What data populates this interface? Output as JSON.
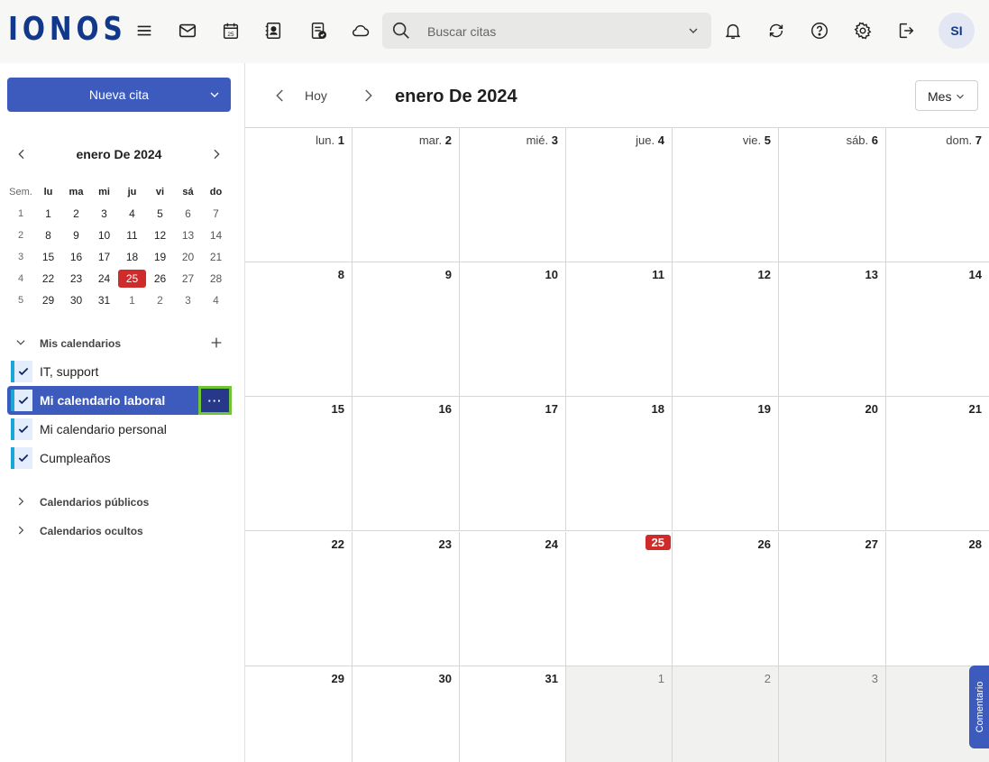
{
  "topbar": {
    "logo": "IONOS",
    "icons": [
      "menu-icon",
      "mail-icon",
      "calendar-icon",
      "contacts-icon",
      "tasks-icon",
      "cloud-icon"
    ],
    "calendar_icon_day": "25",
    "search_placeholder": "Buscar citas",
    "right_icons": [
      "bell-icon",
      "refresh-icon",
      "help-icon",
      "gear-icon",
      "logout-icon"
    ],
    "avatar": "SI"
  },
  "sidebar": {
    "new_button": "Nueva cita",
    "mini": {
      "title": "enero De 2024",
      "week_header": "Sem.",
      "day_headers": [
        "lu",
        "ma",
        "mi",
        "ju",
        "vi",
        "sá",
        "do"
      ],
      "weeks": [
        {
          "wk": "1",
          "days": [
            "1",
            "2",
            "3",
            "4",
            "5",
            "6",
            "7"
          ]
        },
        {
          "wk": "2",
          "days": [
            "8",
            "9",
            "10",
            "11",
            "12",
            "13",
            "14"
          ]
        },
        {
          "wk": "3",
          "days": [
            "15",
            "16",
            "17",
            "18",
            "19",
            "20",
            "21"
          ]
        },
        {
          "wk": "4",
          "days": [
            "22",
            "23",
            "24",
            "25",
            "26",
            "27",
            "28"
          ]
        },
        {
          "wk": "5",
          "days": [
            "29",
            "30",
            "31",
            "1",
            "2",
            "3",
            "4"
          ]
        }
      ]
    },
    "my_calendars": "Mis calendarios",
    "calendars": [
      "IT, support",
      "Mi calendario laboral",
      "Mi calendario personal",
      "Cumpleaños"
    ],
    "more_label": "···",
    "public_calendars": "Calendarios públicos",
    "hidden_calendars": "Calendarios ocultos"
  },
  "main": {
    "today": "Hoy",
    "title": "enero De 2024",
    "view": "Mes",
    "header_days": [
      {
        "name": "lun.",
        "num": "1"
      },
      {
        "name": "mar.",
        "num": "2"
      },
      {
        "name": "mié.",
        "num": "3"
      },
      {
        "name": "jue.",
        "num": "4"
      },
      {
        "name": "vie.",
        "num": "5"
      },
      {
        "name": "sáb.",
        "num": "6"
      },
      {
        "name": "dom.",
        "num": "7"
      }
    ],
    "weeks": [
      [
        "8",
        "9",
        "10",
        "11",
        "12",
        "13",
        "14"
      ],
      [
        "15",
        "16",
        "17",
        "18",
        "19",
        "20",
        "21"
      ],
      [
        "22",
        "23",
        "24",
        "25",
        "26",
        "27",
        "28"
      ],
      [
        "29",
        "30",
        "31",
        "1",
        "2",
        "3",
        ""
      ]
    ]
  },
  "feedback_tab": "Comentario"
}
